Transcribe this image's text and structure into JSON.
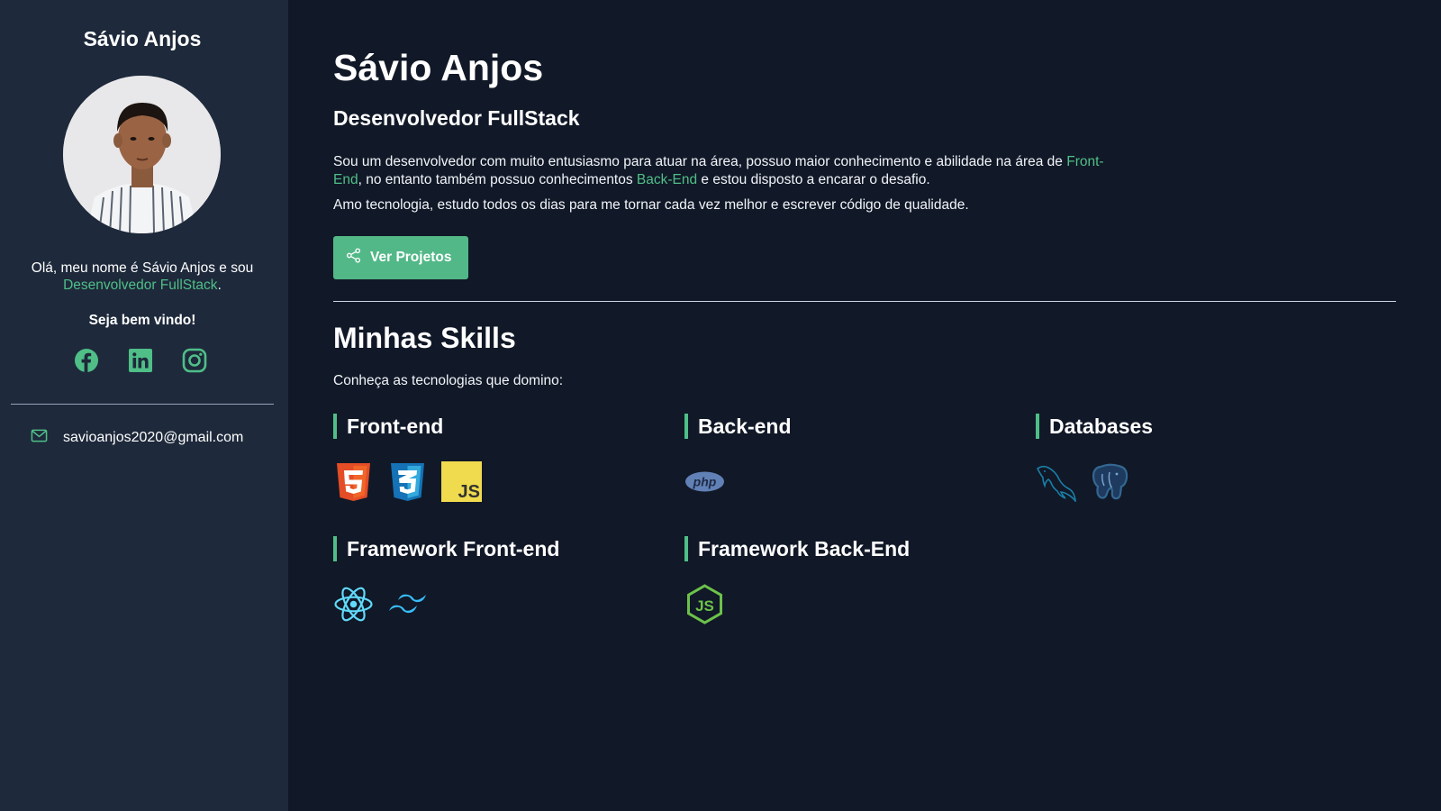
{
  "sidebar": {
    "name": "Sávio Anjos",
    "avatar_icon": "profile-photo",
    "intro_text": "Olá, meu nome é Sávio Anjos e sou",
    "intro_highlight": "Desenvolvedor FullStack",
    "intro_end": ".",
    "welcome": "Seja bem vindo!",
    "socials": [
      {
        "icon": "facebook-icon"
      },
      {
        "icon": "linkedin-icon"
      },
      {
        "icon": "instagram-icon"
      }
    ],
    "email_icon": "mail-icon",
    "email": "savioanjos2020@gmail.com"
  },
  "main": {
    "name": "Sávio Anjos",
    "role": "Desenvolvedor FullStack",
    "about": {
      "p1_a": "Sou um desenvolvedor com muito entusiasmo para atuar na área, possuo maior conhecimento e abilidade na área de ",
      "p1_hl1": "Front-End",
      "p1_b": ", no entanto também possuo conhecimentos ",
      "p1_hl2": "Back-End",
      "p1_c": " e estou disposto a encarar o desafio.",
      "p2": "Amo tecnologia, estudo todos os dias para me tornar cada vez melhor e escrever código de qualidade."
    },
    "projects_button": {
      "label": "Ver Projetos",
      "icon": "share-icon"
    },
    "skills_title": "Minhas Skills",
    "skills_subtitle": "Conheça as tecnologias que domino:",
    "categories": {
      "frontend": {
        "title": "Front-end",
        "icons": [
          "html5-icon",
          "css3-icon",
          "javascript-icon"
        ]
      },
      "backend": {
        "title": "Back-end",
        "icons": [
          "php-icon"
        ]
      },
      "databases": {
        "title": "Databases",
        "icons": [
          "mysql-icon",
          "postgresql-icon"
        ]
      },
      "framework_frontend": {
        "title": "Framework Front-end",
        "icons": [
          "react-icon",
          "tailwind-icon"
        ]
      },
      "framework_backend": {
        "title": "Framework Back-End",
        "icons": [
          "nodejs-icon"
        ]
      }
    }
  },
  "colors": {
    "background": "#111827",
    "sidebar": "#1e293b",
    "accent": "#4fbf87",
    "button": "#52b888"
  }
}
